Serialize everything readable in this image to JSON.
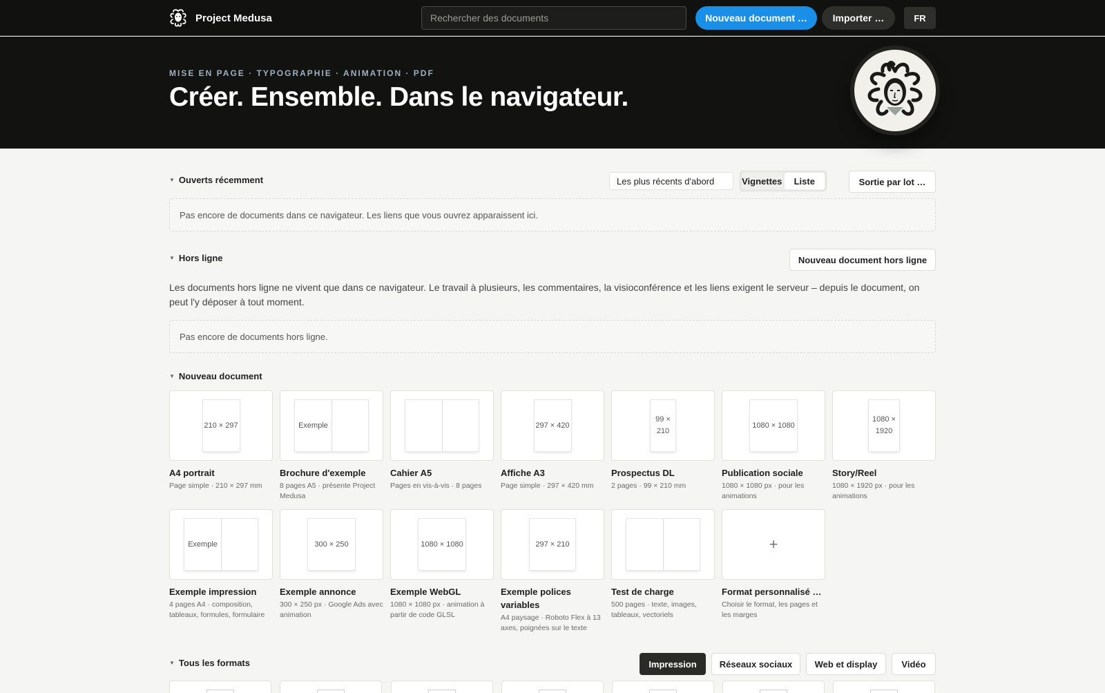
{
  "topbar": {
    "brand": "Project Medusa",
    "search_placeholder": "Rechercher des documents",
    "new_document": "Nouveau document …",
    "import": "Importer …",
    "language": "FR"
  },
  "hero": {
    "tags": "MISE EN PAGE · TYPOGRAPHIE · ANIMATION · PDF",
    "title": "Créer. Ensemble. Dans le navigateur."
  },
  "recent": {
    "title": "Ouverts récemment",
    "sort_value": "Les plus récents d'abord",
    "view_thumbnails": "Vignettes",
    "view_list": "Liste",
    "batch_output": "Sortie par lot …",
    "empty": "Pas encore de documents dans ce navigateur. Les liens que vous ouvrez apparaissent ici."
  },
  "offline": {
    "title": "Hors ligne",
    "new_offline": "Nouveau document hors ligne",
    "description": "Les documents hors ligne ne vivent que dans ce navigateur. Le travail à plusieurs, les commentaires, la visioconférence et les liens exigent le serveur – depuis le document, on peut l'y déposer à tout moment.",
    "empty": "Pas encore de documents hors ligne."
  },
  "new_document": {
    "title": "Nouveau document",
    "templates": [
      {
        "title": "A4 portrait",
        "subtitle": "Page simple · 210 × 297 mm",
        "preview": "210 × 297"
      },
      {
        "title": "Brochure d'exemple",
        "subtitle": "8 pages A5 · présente Project Medusa",
        "preview": "Exemple"
      },
      {
        "title": "Cahier A5",
        "subtitle": "Pages en vis-à-vis · 8 pages",
        "preview": ""
      },
      {
        "title": "Affiche A3",
        "subtitle": "Page simple · 297 × 420 mm",
        "preview": "297 × 420"
      },
      {
        "title": "Prospectus DL",
        "subtitle": "2 pages · 99 × 210 mm",
        "preview": "99 × 210"
      },
      {
        "title": "Publication sociale",
        "subtitle": "1080 × 1080 px · pour les animations",
        "preview": "1080 × 1080"
      },
      {
        "title": "Story/Reel",
        "subtitle": "1080 × 1920 px · pour les animations",
        "preview": "1080 × 1920"
      },
      {
        "title": "Exemple impression",
        "subtitle": "4 pages A4 · composition, tableaux, formules, formulaire",
        "preview": "Exemple"
      },
      {
        "title": "Exemple annonce",
        "subtitle": "300 × 250 px · Google Ads avec animation",
        "preview": "300 × 250"
      },
      {
        "title": "Exemple WebGL",
        "subtitle": "1080 × 1080 px · animation à partir de code GLSL",
        "preview": "1080 × 1080"
      },
      {
        "title": "Exemple polices variables",
        "subtitle": "A4 paysage · Roboto Flex à 13 axes, poignées sur le texte",
        "preview": "297 × 210"
      },
      {
        "title": "Test de charge",
        "subtitle": "500 pages · texte, images, tableaux, vectoriels",
        "preview": ""
      },
      {
        "title": "Format personnalisé …",
        "subtitle": "Choisir le format, les pages et les marges",
        "preview": "+"
      }
    ]
  },
  "all_formats": {
    "title": "Tous les formats",
    "tabs": [
      "Impression",
      "Réseaux sociaux",
      "Web et display",
      "Vidéo"
    ],
    "active_tab": "Impression"
  }
}
